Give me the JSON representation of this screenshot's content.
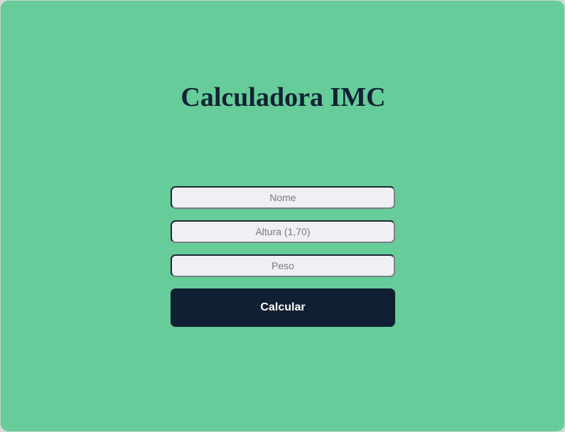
{
  "page": {
    "title": "Calculadora IMC"
  },
  "form": {
    "name_placeholder": "Nome",
    "name_value": "",
    "height_placeholder": "Altura (1,70)",
    "height_value": "",
    "weight_placeholder": "Peso",
    "weight_value": "",
    "submit_label": "Calcular"
  },
  "colors": {
    "background": "#66cc99",
    "title": "#112233",
    "button": "#102033",
    "input_background": "#eef0f4"
  }
}
